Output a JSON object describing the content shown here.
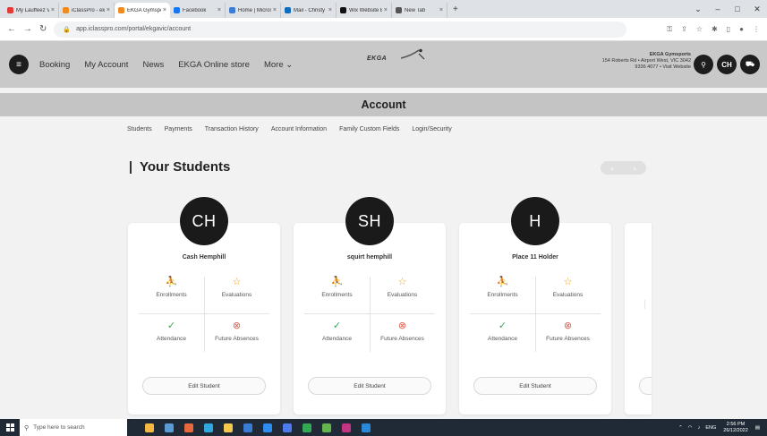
{
  "browser": {
    "tabs": [
      {
        "label": "My Lauffeez Vault",
        "color": "#e53935",
        "active": false
      },
      {
        "label": "iClassPro - ekgavic",
        "color": "#f28b1d",
        "active": false
      },
      {
        "label": "EKGA Gymsports",
        "color": "#f28b1d",
        "active": true
      },
      {
        "label": "Facebook",
        "color": "#1877f2",
        "active": false
      },
      {
        "label": "Home | Microsoft",
        "color": "#3c7bd6",
        "active": false
      },
      {
        "label": "Mail - Christy",
        "color": "#0f6cbd",
        "active": false
      },
      {
        "label": "Wix Website Editor",
        "color": "#111111",
        "active": false
      },
      {
        "label": "New Tab",
        "color": "#555555",
        "active": false
      }
    ],
    "url": "app.iclasspro.com/portal/ekgavic/account"
  },
  "header": {
    "nav": [
      "Booking",
      "My Account",
      "News",
      "EKGA Online store",
      "More ⌄"
    ],
    "logo_text": "EKGA",
    "address_name": "EKGA Gymsports",
    "address_line1": "154 Roberts Rd • Airport West, VIC 3042",
    "address_line2": "9336 4077 • Visit Website",
    "user_initials": "CH"
  },
  "page": {
    "title": "Account",
    "subnav": [
      "Students",
      "Payments",
      "Transaction History",
      "Account Information",
      "Family Custom Fields",
      "Login/Security"
    ],
    "section_title": "Your Students"
  },
  "students": [
    {
      "initials": "CH",
      "name": "Cash Hemphill"
    },
    {
      "initials": "SH",
      "name": "squirt hemphill"
    },
    {
      "initials": "H",
      "name": "Place 11 Holder"
    }
  ],
  "card_labels": {
    "enrollments": "Enrollments",
    "evaluations": "Evaluations",
    "attendance": "Attendance",
    "future_absences": "Future Absences",
    "edit": "Edit Student"
  },
  "taskbar": {
    "search_placeholder": "Type here to search",
    "lang": "ENG",
    "time": "2:56 PM",
    "date": "26/12/2022"
  },
  "colors": {
    "header_bg": "#c9c9c9",
    "account_band": "#c4c4c4",
    "avatar": "#1a1a1a",
    "icon_blue": "#4a8fd6",
    "icon_star": "#e8a317",
    "icon_green": "#3aa757",
    "icon_red": "#e05a4a"
  }
}
